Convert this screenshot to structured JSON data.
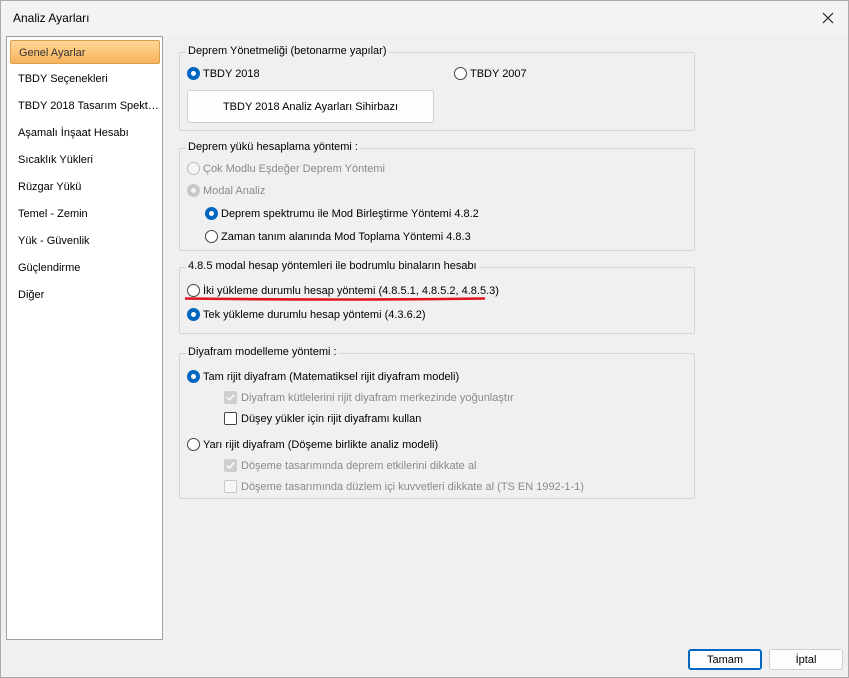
{
  "window": {
    "title": "Analiz Ayarları"
  },
  "sidebar": {
    "items": [
      {
        "label": "Genel Ayarlar",
        "selected": true
      },
      {
        "label": "TBDY Seçenekleri"
      },
      {
        "label": "TBDY 2018 Tasarım Spekt…"
      },
      {
        "label": "Aşamalı İnşaat Hesabı"
      },
      {
        "label": "Sıcaklık Yükleri"
      },
      {
        "label": "Rüzgar Yükü"
      },
      {
        "label": "Temel - Zemin"
      },
      {
        "label": "Yük - Güvenlik"
      },
      {
        "label": "Güçlendirme"
      },
      {
        "label": "Diğer"
      }
    ]
  },
  "deprem_yonetmeligi": {
    "title": "Deprem Yönetmeliği (betonarme yapılar)",
    "tbdy2018": "TBDY 2018",
    "tbdy2007": "TBDY 2007",
    "selected": "TBDY 2018",
    "wizard_button": "TBDY 2018 Analiz Ayarları Sihirbazı"
  },
  "deprem_yuku": {
    "title": "Deprem yükü hesaplama yöntemi :",
    "cok_modlu": "Çok Modlu Eşdeğer Deprem Yöntemi",
    "modal_analiz": "Modal Analiz",
    "spektrum": "Deprem spektrumu ile Mod Birleştirme Yöntemi 4.8.2",
    "zaman_tanim": "Zaman tanım alanında Mod Toplama Yöntemi 4.8.3"
  },
  "bodrumlu": {
    "title": "4.8.5 modal hesap yöntemleri ile bodrumlu binaların hesabı",
    "iki_yukleme": "İki yükleme durumlu hesap yöntemi (4.8.5.1, 4.8.5.2, 4.8.5.3)",
    "tek_yukleme": "Tek yükleme durumlu hesap yöntemi (4.3.6.2)",
    "highlight_color": "#e0141e"
  },
  "diyafram": {
    "title": "Diyafram modelleme yöntemi  :",
    "tam_rijit": "Tam rijit diyafram (Matematiksel rijit diyafram modeli)",
    "kutleler": "Diyafram kütlelerini rijit diyafram merkezinde yoğunlaştır",
    "duseY": "Düşey yükler için rijit diyaframı kullan",
    "yari_rijit": "Yarı rijit diyafram (Döşeme birlikte analiz modeli)",
    "deprem_etki": "Döşeme tasarımında deprem etkilerini dikkate al",
    "duzlem_ici": "Döşeme tasarımında düzlem içi kuvvetleri dikkate al (TS EN 1992-1-1)"
  },
  "footer": {
    "ok": "Tamam",
    "cancel": "İptal"
  },
  "colors": {
    "accent": "#0067c0",
    "selection": "#f9b35a"
  }
}
